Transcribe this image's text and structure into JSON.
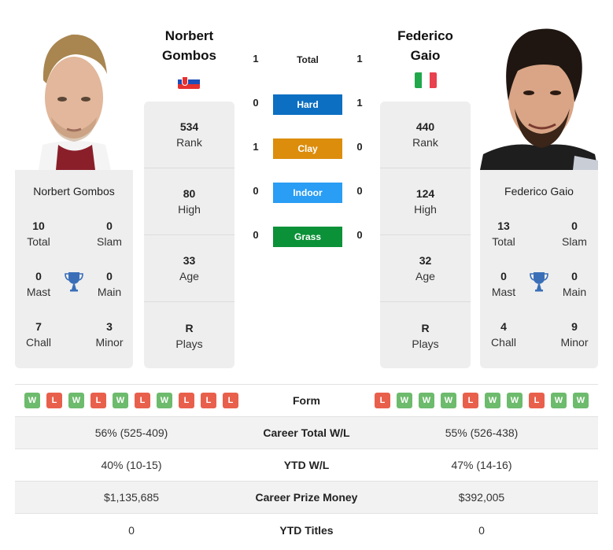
{
  "colors": {
    "hard": "#0c6fc1",
    "clay": "#dc8d0c",
    "indoor": "#2a9df4",
    "grass": "#0b9138",
    "win": "#6dbb6d",
    "loss": "#e8604c",
    "trophy": "#3a6fb8",
    "panel": "#eeeeee"
  },
  "player1": {
    "name_line1": "Norbert",
    "name_line2": "Gombos",
    "full_name": "Norbert Gombos",
    "flag": "slovakia-flag",
    "photo": "player-photo",
    "stats": [
      {
        "value": "534",
        "label": "Rank"
      },
      {
        "value": "80",
        "label": "High"
      },
      {
        "value": "33",
        "label": "Age"
      },
      {
        "value": "R",
        "label": "Plays"
      }
    ],
    "titles": {
      "total": {
        "value": "10",
        "label": "Total"
      },
      "slam": {
        "value": "0",
        "label": "Slam"
      },
      "mast": {
        "value": "0",
        "label": "Mast"
      },
      "main": {
        "value": "0",
        "label": "Main"
      },
      "chall": {
        "value": "7",
        "label": "Chall"
      },
      "minor": {
        "value": "3",
        "label": "Minor"
      }
    },
    "form": [
      "W",
      "L",
      "W",
      "L",
      "W",
      "L",
      "W",
      "L",
      "L",
      "L"
    ],
    "career_wl": "56% (525-409)",
    "ytd_wl": "40% (10-15)",
    "prize_money": "$1,135,685",
    "ytd_titles": "0"
  },
  "player2": {
    "name_line1": "Federico",
    "name_line2": "Gaio",
    "full_name": "Federico Gaio",
    "flag": "italy-flag",
    "photo": "player-photo",
    "stats": [
      {
        "value": "440",
        "label": "Rank"
      },
      {
        "value": "124",
        "label": "High"
      },
      {
        "value": "32",
        "label": "Age"
      },
      {
        "value": "R",
        "label": "Plays"
      }
    ],
    "titles": {
      "total": {
        "value": "13",
        "label": "Total"
      },
      "slam": {
        "value": "0",
        "label": "Slam"
      },
      "mast": {
        "value": "0",
        "label": "Mast"
      },
      "main": {
        "value": "0",
        "label": "Main"
      },
      "chall": {
        "value": "4",
        "label": "Chall"
      },
      "minor": {
        "value": "9",
        "label": "Minor"
      }
    },
    "form": [
      "L",
      "W",
      "W",
      "W",
      "L",
      "W",
      "W",
      "L",
      "W",
      "W"
    ],
    "career_wl": "55% (526-438)",
    "ytd_wl": "47% (14-16)",
    "prize_money": "$392,005",
    "ytd_titles": "0"
  },
  "h2h": {
    "total": {
      "label": "Total",
      "p1": "1",
      "p2": "1"
    },
    "surfaces": [
      {
        "label": "Hard",
        "p1": "0",
        "p2": "1"
      },
      {
        "label": "Clay",
        "p1": "1",
        "p2": "0"
      },
      {
        "label": "Indoor",
        "p1": "0",
        "p2": "0"
      },
      {
        "label": "Grass",
        "p1": "0",
        "p2": "0"
      }
    ]
  },
  "table": {
    "form_label": "Form",
    "career_wl_label": "Career Total W/L",
    "ytd_wl_label": "YTD W/L",
    "prize_label": "Career Prize Money",
    "ytd_titles_label": "YTD Titles"
  }
}
